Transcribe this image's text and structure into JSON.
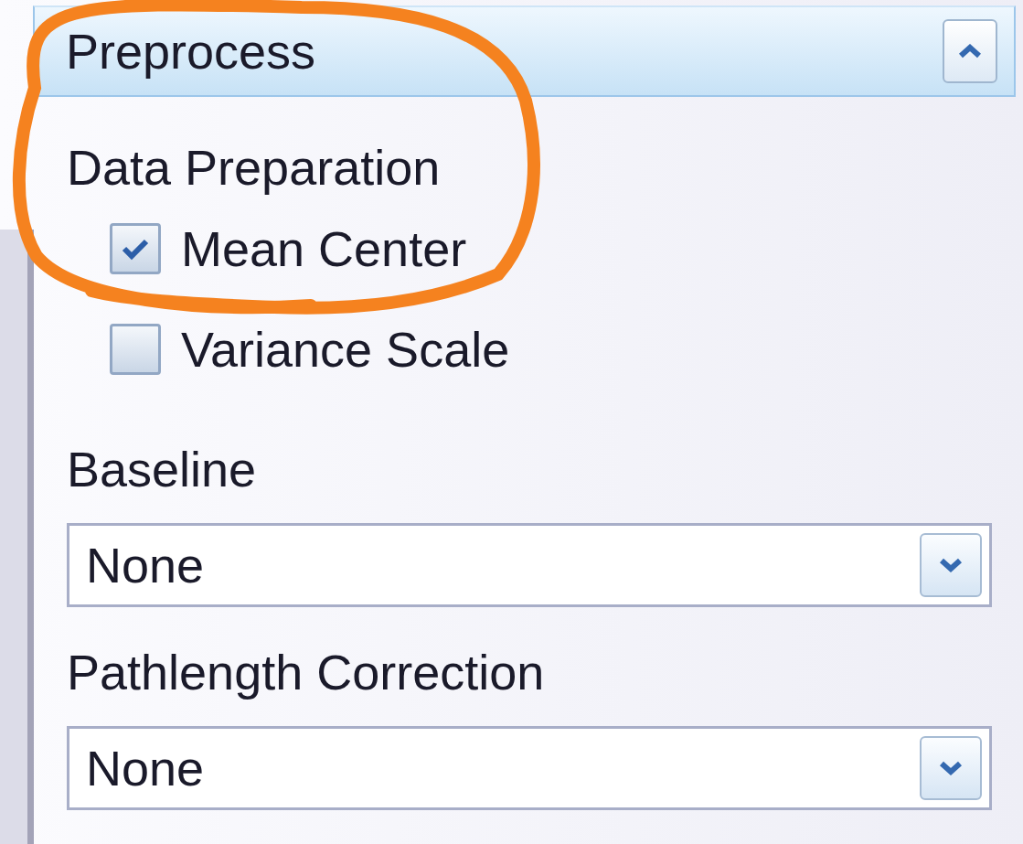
{
  "header": {
    "title": "Preprocess",
    "expanded": true
  },
  "items": [
    {
      "kind": "heading",
      "label": "Data Preparation"
    },
    {
      "kind": "checkbox",
      "label": "Mean Center",
      "checked": true
    },
    {
      "kind": "checkbox",
      "label": "Variance Scale",
      "checked": false
    },
    {
      "kind": "heading",
      "label": "Baseline"
    },
    {
      "kind": "dropdown",
      "value": "None"
    },
    {
      "kind": "heading",
      "label": "Pathlength Correction"
    },
    {
      "kind": "dropdown",
      "value": "None"
    }
  ]
}
